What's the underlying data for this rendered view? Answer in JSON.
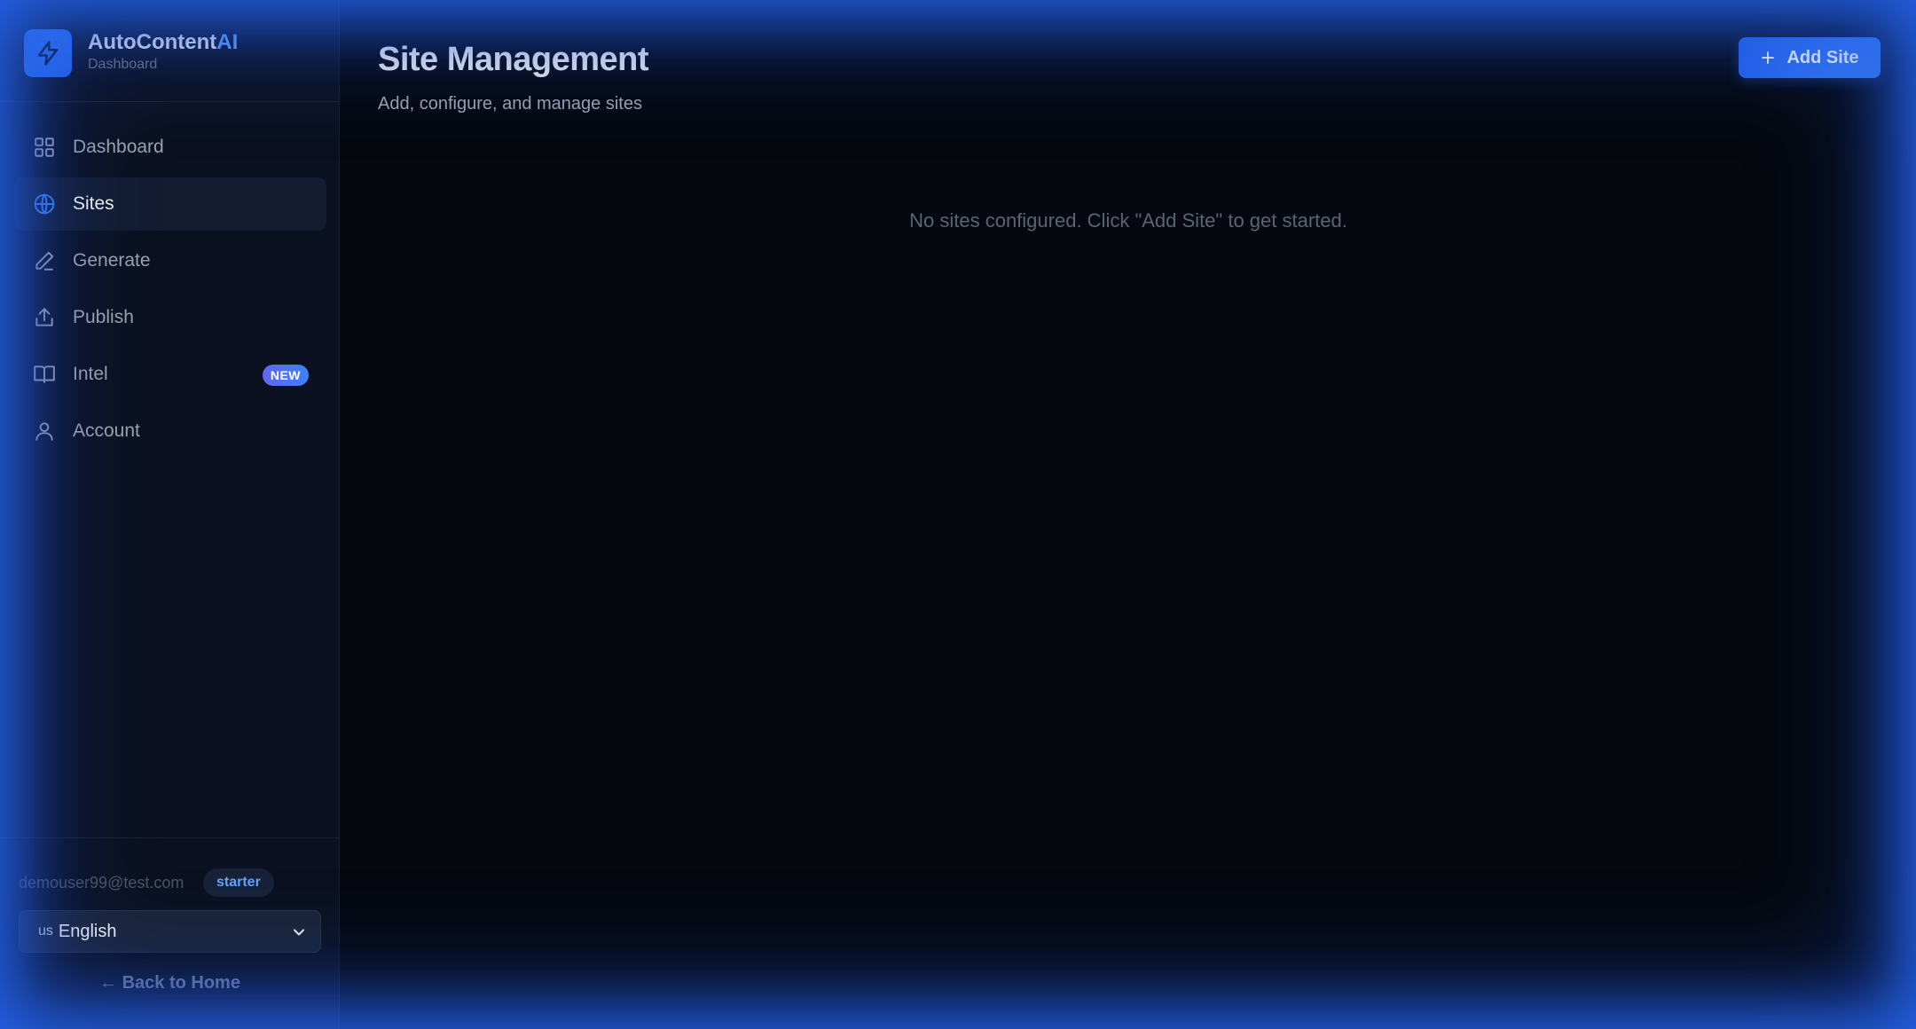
{
  "brand": {
    "name_main": "AutoContent",
    "name_accent": "AI",
    "subtitle": "Dashboard"
  },
  "sidebar": {
    "items": [
      {
        "label": "Dashboard",
        "icon": "grid-icon",
        "active": false
      },
      {
        "label": "Sites",
        "icon": "globe-icon",
        "active": true
      },
      {
        "label": "Generate",
        "icon": "pen-icon",
        "active": false
      },
      {
        "label": "Publish",
        "icon": "upload-icon",
        "active": false
      },
      {
        "label": "Intel",
        "icon": "book-icon",
        "active": false,
        "badge": "NEW"
      },
      {
        "label": "Account",
        "icon": "user-icon",
        "active": false
      }
    ]
  },
  "user": {
    "email": "demouser99@test.com",
    "plan": "starter"
  },
  "language": {
    "flag": "us",
    "selected": "English"
  },
  "back_link": "← Back to Home",
  "main": {
    "title": "Site Management",
    "subtitle": "Add, configure, and manage sites",
    "add_button": "Add Site",
    "empty_message": "No sites configured. Click \"Add Site\" to get started."
  },
  "colors": {
    "accent": "#3b82f6",
    "background": "#05080e",
    "sidebar": "#0b1120",
    "glow": "#2563eb"
  }
}
